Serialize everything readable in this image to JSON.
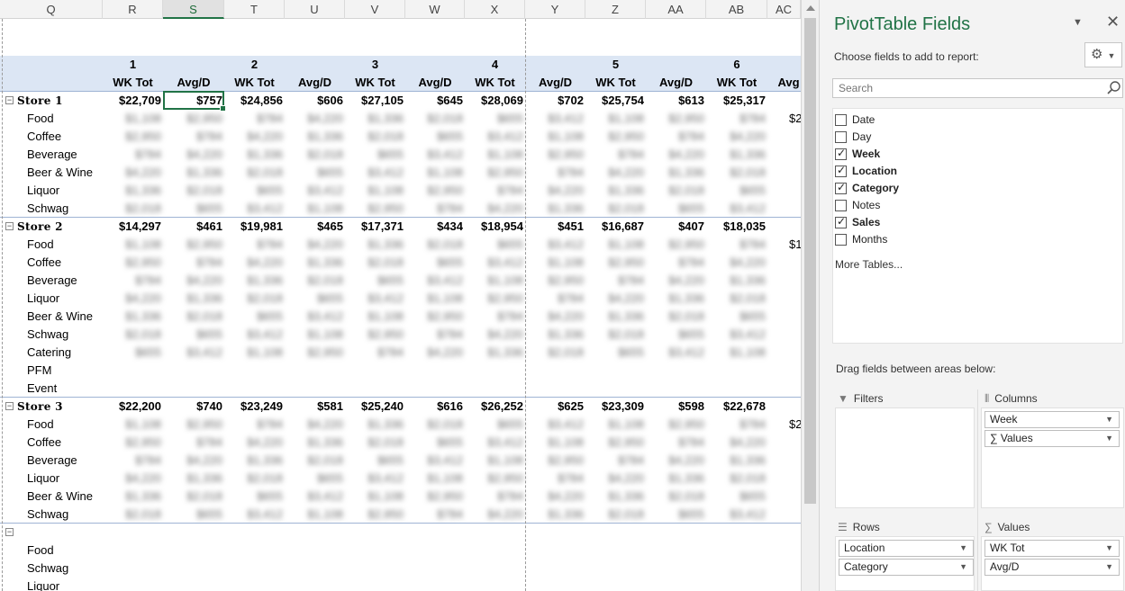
{
  "columns": [
    "Q",
    "R",
    "S",
    "T",
    "U",
    "V",
    "W",
    "X",
    "Y",
    "Z",
    "AA",
    "AB",
    "AC"
  ],
  "selected_column": "S",
  "week_headers": [
    "1",
    "2",
    "3",
    "4",
    "5",
    "6"
  ],
  "measure_headers": [
    "WK Tot",
    "Avg/D",
    "WK Tot",
    "Avg/D",
    "WK Tot",
    "Avg/D",
    "WK Tot",
    "Avg/D",
    "WK Tot",
    "Avg/D",
    "WK Tot",
    "Avg"
  ],
  "stores": [
    {
      "label": "Store 1",
      "totals": [
        "$22,709",
        "$757",
        "$24,856",
        "$606",
        "$27,105",
        "$645",
        "$28,069",
        "$702",
        "$25,754",
        "$613",
        "$25,317"
      ],
      "categories": [
        "Food",
        "Coffee",
        "Beverage",
        "Beer & Wine",
        "Liquor",
        "Schwag"
      ]
    },
    {
      "label": "Store 2",
      "totals": [
        "$14,297",
        "$461",
        "$19,981",
        "$465",
        "$17,371",
        "$434",
        "$18,954",
        "$451",
        "$16,687",
        "$407",
        "$18,035"
      ],
      "categories": [
        "Food",
        "Coffee",
        "Beverage",
        "Liquor",
        "Beer & Wine",
        "Schwag",
        "Catering",
        "PFM",
        "Event"
      ]
    },
    {
      "label": "Store 3",
      "totals": [
        "$22,200",
        "$740",
        "$23,249",
        "$581",
        "$25,240",
        "$616",
        "$26,252",
        "$625",
        "$23,309",
        "$598",
        "$22,678"
      ],
      "categories": [
        "Food",
        "Coffee",
        "Beverage",
        "Liquor",
        "Beer & Wine",
        "Schwag"
      ]
    },
    {
      "label": "",
      "totals": [],
      "categories": [
        "Food",
        "Schwag",
        "Liquor"
      ]
    }
  ],
  "edge_values": [
    "$2",
    "$1",
    "$2"
  ],
  "pane": {
    "title": "PivotTable Fields",
    "subtitle": "Choose fields to add to report:",
    "search_placeholder": "Search",
    "fields": [
      {
        "label": "Date",
        "checked": false
      },
      {
        "label": "Day",
        "checked": false
      },
      {
        "label": "Week",
        "checked": true
      },
      {
        "label": "Location",
        "checked": true
      },
      {
        "label": "Category",
        "checked": true
      },
      {
        "label": "Notes",
        "checked": false
      },
      {
        "label": "Sales",
        "checked": true
      },
      {
        "label": "Months",
        "checked": false
      }
    ],
    "more_tables": "More Tables...",
    "drag_label": "Drag fields between areas below:",
    "areas": {
      "filters": {
        "title": "Filters",
        "items": []
      },
      "columns": {
        "title": "Columns",
        "items": [
          "Week",
          "∑ Values"
        ]
      },
      "rows": {
        "title": "Rows",
        "items": [
          "Location",
          "Category"
        ]
      },
      "values": {
        "title": "Values",
        "items": [
          "WK Tot",
          "Avg/D"
        ]
      }
    }
  }
}
